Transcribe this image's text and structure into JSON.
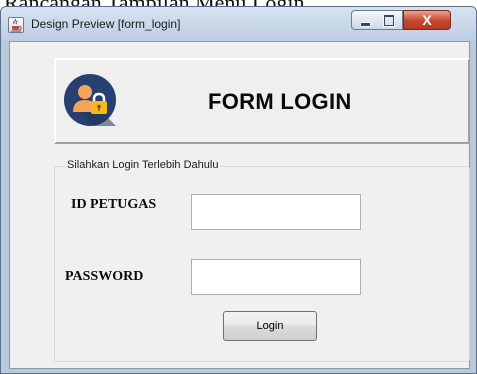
{
  "document": {
    "caption": "Rancangan Tampilan Menu Login."
  },
  "window": {
    "title": "Design Preview [form_login]",
    "app_icon": "java-cup-icon",
    "controls": {
      "minimize_icon": "minimize-icon",
      "maximize_icon": "maximize-icon",
      "close_icon": "close-icon",
      "close_glyph": "X"
    }
  },
  "header": {
    "title": "FORM LOGIN",
    "icon": "user-lock-icon"
  },
  "login_panel": {
    "legend": "Silahkan Login Terlebih Dahulu",
    "id_label": "ID PETUGAS",
    "id_value": "",
    "password_label": "PASSWORD",
    "password_value": "",
    "login_button": "Login"
  },
  "colors": {
    "icon_circle": "#28406f",
    "icon_person": "#f5a55a",
    "lock_body": "#f6b91e",
    "close_button": "#c7452d",
    "window_frame": "#b9c9dc"
  }
}
